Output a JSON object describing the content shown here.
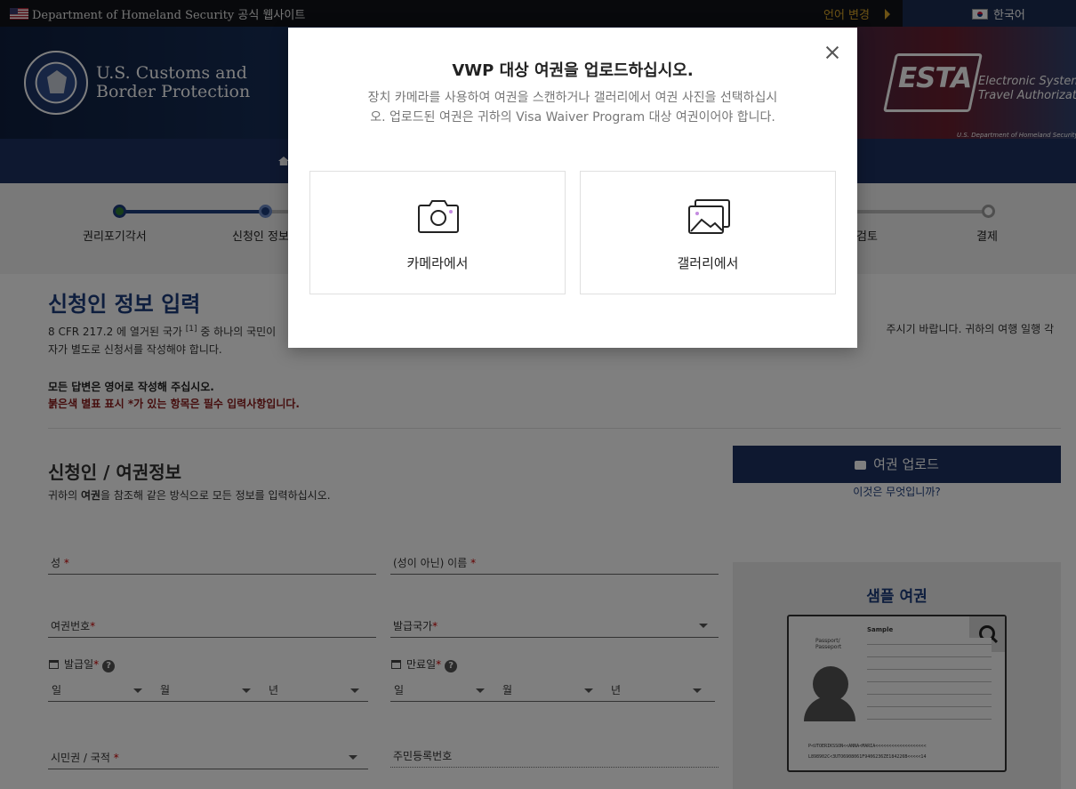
{
  "govbar": {
    "site_text": "Department of Homeland Security 공식 웹사이트",
    "change_language": "언어 변경",
    "current_language": "한국어"
  },
  "header": {
    "agency_line1": "U.S. Customs and",
    "agency_line2": "Border Protection",
    "esta_word": "ESTA",
    "esta_full_line1": "Electronic System fo",
    "esta_full_line2": "Travel Authorization",
    "esta_dept": "U.S. Department of Homeland Security"
  },
  "progress": {
    "steps": [
      {
        "label": "권리포기각서",
        "state": "complete"
      },
      {
        "label": "신청인 정보",
        "state": "current"
      },
      {
        "label": "검토",
        "state": "pending"
      },
      {
        "label": "결제",
        "state": "pending"
      }
    ]
  },
  "main": {
    "title": "신청인 정보 입력",
    "intro_before_sup": "8 CFR 217.2 에 열거된 국가 ",
    "intro_sup": "[1]",
    "intro_after_sup": " 중 하나의 국민이",
    "intro_right": "주시기 바랍니다. 귀하의 여행 일행 각",
    "intro_line2": "자가 별도로 신청서를 작성해야 합니다.",
    "english_note": "모든 답변은 영어로 작성해 주십시오.",
    "required_note": "붉은색 별표 표시 *가 있는 항목은 필수 입력사항입니다.",
    "section_title": "신청인 / 여권정보",
    "section_sub_before": "귀하의 ",
    "section_sub_bold": "여권",
    "section_sub_after": "을 참조해 같은 방식으로 모든 정보를 입력하십시오."
  },
  "form": {
    "surname_label": "성",
    "given_name_label": "(성이 아닌) 이름",
    "passport_number_label": "여권번호",
    "issuing_country_label": "발급국가",
    "issue_date_label": "발급일",
    "expiry_date_label": "만료일",
    "day": "일",
    "month": "월",
    "year": "년",
    "citizenship_label": "시민권 / 국적",
    "national_id_label": "주민등록번호",
    "required_mark": "*",
    "help_mark": "?"
  },
  "sidebar": {
    "upload_button": "여권 업로드",
    "what_is_this": "이것은 무엇입니까?",
    "sample_title": "샘플 여권",
    "passport_sample_word": "Sample",
    "passport_type": "Passport/ Passeport",
    "mrz_line1": "P<UTOERIKSSON<<ANNA<MARIA<<<<<<<<<<<<<<<<<<<",
    "mrz_line2": "L898902C<3UTO6908061F9406236ZE184226B<<<<<14"
  },
  "modal": {
    "title": "VWP 대상 여권을 업로드하십시오.",
    "description": "장치 카메라를 사용하여 여권을 스캔하거나 갤러리에서 여권 사진을 선택하십시오. 업로드된 여권은 귀하의 Visa Waiver Program 대상 여권이어야 합니다.",
    "camera_option": "카메라에서",
    "gallery_option": "갤러리에서"
  },
  "colors": {
    "navy": "#1d3161",
    "title_blue": "#1d3d7c",
    "required_red": "#c00000",
    "step_complete": "#2e7d32",
    "gold": "#d8a52b"
  }
}
